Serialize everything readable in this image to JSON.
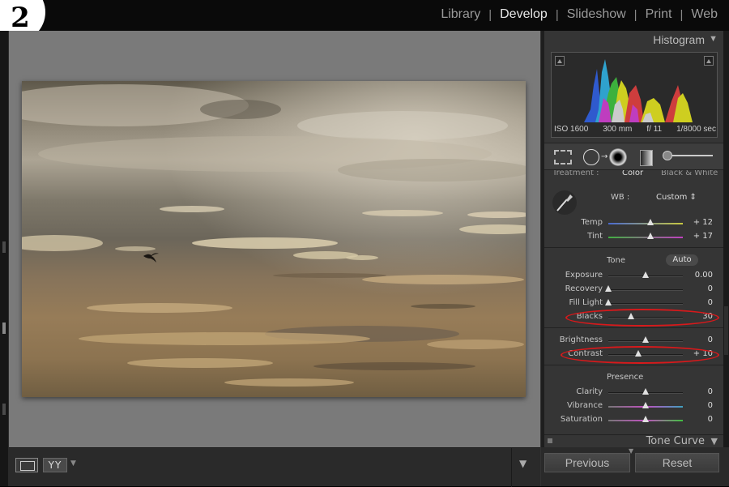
{
  "step_badge": "2",
  "modules": {
    "items": [
      "Library",
      "Develop",
      "Slideshow",
      "Print",
      "Web"
    ],
    "active": "Develop",
    "separator": "|"
  },
  "histogram": {
    "title": "Histogram",
    "iso": "ISO 1600",
    "focal": "300 mm",
    "aperture": "f/ 11",
    "shutter": "1/8000 sec",
    "collapse_icon": "triangle-down-icon"
  },
  "basic": {
    "treatment_label": "Treatment :",
    "treatment_color": "Color",
    "treatment_bw": "Black & White",
    "wb_label": "WB :",
    "wb_value": "Custom ⇕",
    "temp": {
      "label": "Temp",
      "value": "+ 12",
      "level": 0.56
    },
    "tint": {
      "label": "Tint",
      "value": "+ 17",
      "level": 0.57
    },
    "tone_title": "Tone",
    "auto_label": "Auto",
    "exposure": {
      "label": "Exposure",
      "value": "0.00",
      "level": 0.5
    },
    "recovery": {
      "label": "Recovery",
      "value": "0",
      "level": 0.0
    },
    "fill_light": {
      "label": "Fill Light",
      "value": "0",
      "level": 0.0
    },
    "blacks": {
      "label": "Blacks",
      "value": "30",
      "level": 0.3
    },
    "brightness": {
      "label": "Brightness",
      "value": "0",
      "level": 0.5
    },
    "contrast": {
      "label": "Contrast",
      "value": "+ 10",
      "level": 0.4
    },
    "presence_title": "Presence",
    "clarity": {
      "label": "Clarity",
      "value": "0",
      "level": 0.5
    },
    "vibrance": {
      "label": "Vibrance",
      "value": "0",
      "level": 0.5
    },
    "saturation": {
      "label": "Saturation",
      "value": "0",
      "level": 0.5
    }
  },
  "tone_curve": {
    "title": "Tone Curve"
  },
  "buttons": {
    "previous": "Previous",
    "reset": "Reset"
  },
  "toolbar": {
    "yy_label": "YY"
  },
  "colors": {
    "highlight_oval": "#d8191b"
  }
}
